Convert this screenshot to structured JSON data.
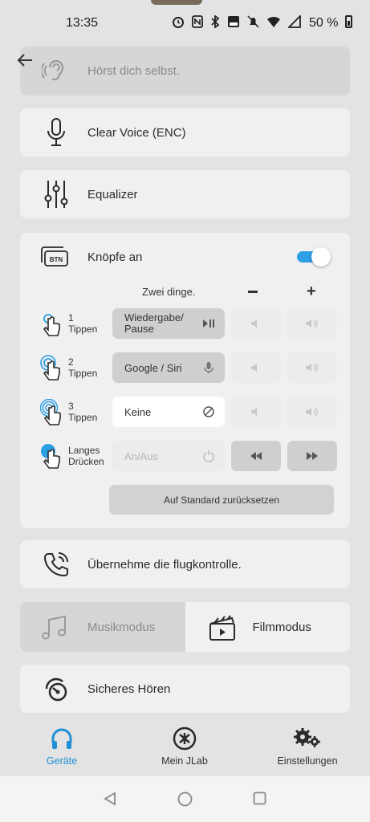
{
  "status": {
    "time": "13:35",
    "battery": "50 %"
  },
  "hear_yourself": {
    "label": "Hörst dich selbst."
  },
  "clear_voice": {
    "label": "Clear Voice (ENC)"
  },
  "equalizer": {
    "label": "Equalizer"
  },
  "buttons_section": {
    "title": "Knöpfe an",
    "icon_text": "BTN",
    "enabled": true,
    "column_header": "Zwei dinge.",
    "minus": "−",
    "plus": "+",
    "rows": [
      {
        "gesture": "1\nTippen",
        "action": "Wiedergabe/\nPause"
      },
      {
        "gesture": "2\nTippen",
        "action": "Google / Siri"
      },
      {
        "gesture": "3\nTippen",
        "action": "Keine"
      },
      {
        "gesture": "Langes\nDrücken",
        "action": "An/Aus"
      }
    ],
    "reset_label": "Auf Standard zurücksetzen"
  },
  "flight_control": {
    "label": "Übernehme die flugkontrolle."
  },
  "modes": {
    "music": "Musikmodus",
    "film": "Filmmodus",
    "selected": "music"
  },
  "safe_hearing": {
    "label": "Sicheres Hören"
  },
  "nav": {
    "devices": "Geräte",
    "my_jlab": "Mein JLab",
    "settings": "Einstellungen",
    "active": "devices"
  },
  "colors": {
    "accent": "#2d9fe6",
    "card": "#f0f0f0",
    "background": "#e3e3e3"
  }
}
